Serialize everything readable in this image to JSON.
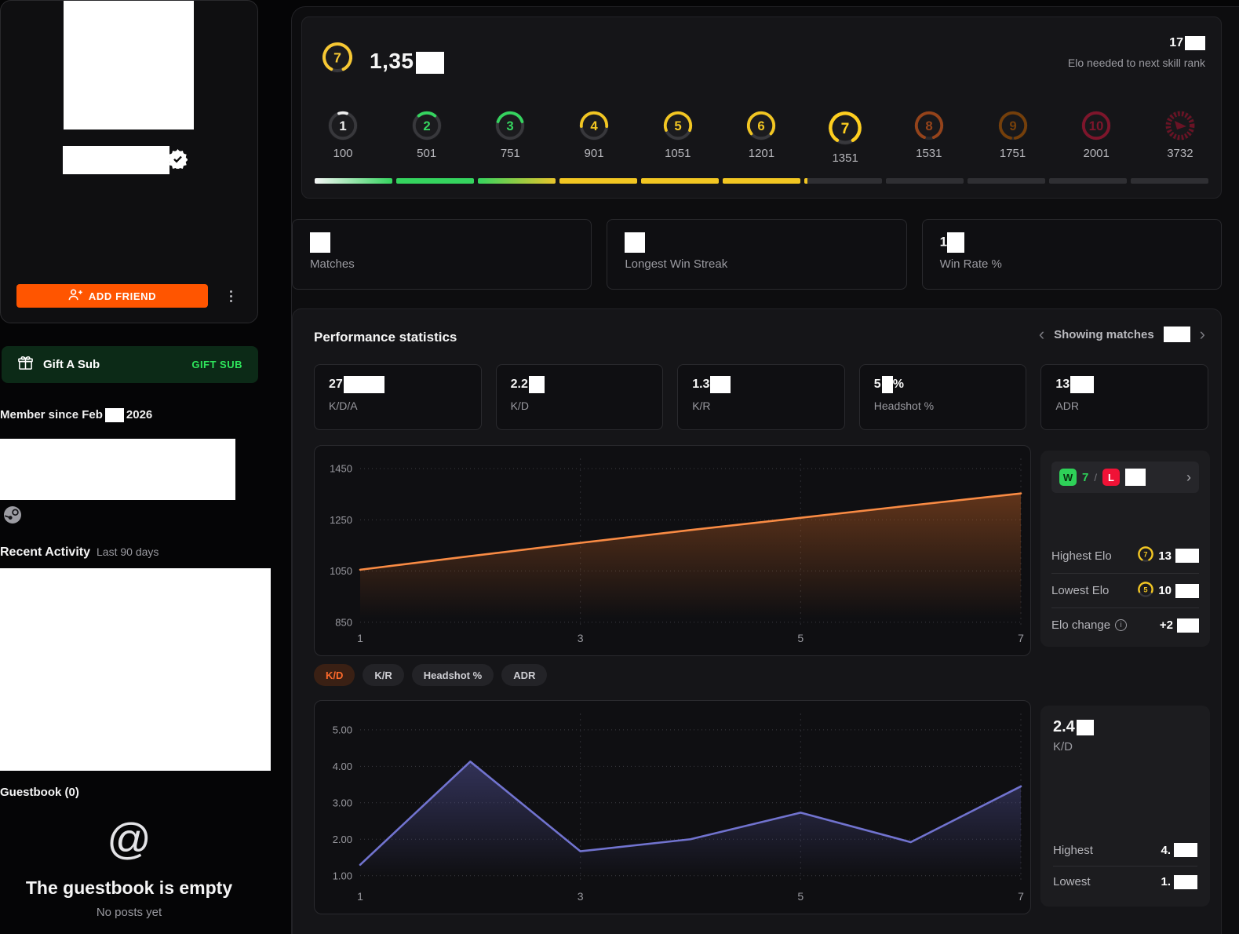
{
  "icons": {
    "chevron_left": "‹",
    "chevron_right": "›",
    "wl_chevron": "›",
    "info": "i",
    "at": "@"
  },
  "sidebar": {
    "add_friend_label": "ADD FRIEND",
    "gift_sub": {
      "title": "Gift A Sub",
      "button": "GIFT SUB"
    },
    "member_since_prefix": "Member since Feb",
    "member_since_suffix": "2026",
    "recent_activity_title": "Recent Activity",
    "recent_activity_range": "Last 90 days",
    "guestbook_title": "Guestbook (0)",
    "guestbook_empty_title": "The guestbook is empty",
    "guestbook_empty_subtitle": "No posts yet"
  },
  "header": {
    "elo_visible": "1,35",
    "badge": {
      "n": 7,
      "color": "#f7c833",
      "arc": 0.85
    },
    "next_rank_value": "17",
    "next_rank_label": "Elo needed to next skill rank"
  },
  "levels": [
    {
      "n": 1,
      "elo": "100",
      "color": "#ededed",
      "arc": 0.1,
      "progress": {
        "fill": "linear-gradient(90deg,#f5f5f5,#35d45f)"
      }
    },
    {
      "n": 2,
      "elo": "501",
      "color": "#35d45f",
      "arc": 0.22,
      "progress": {
        "fill": "#35d45f"
      }
    },
    {
      "n": 3,
      "elo": "751",
      "color": "#35d45f",
      "arc": 0.4,
      "progress": {
        "fill": "linear-gradient(90deg,#35d45f,#e8c52c)"
      }
    },
    {
      "n": 4,
      "elo": "901",
      "color": "#f2c622",
      "arc": 0.52,
      "progress": {
        "fill": "#f2c622"
      }
    },
    {
      "n": 5,
      "elo": "1051",
      "color": "#f2c622",
      "arc": 0.62,
      "progress": {
        "fill": "#f2c622"
      }
    },
    {
      "n": 6,
      "elo": "1201",
      "color": "#f2c622",
      "arc": 0.72,
      "progress": {
        "fill": "#f2c622"
      }
    },
    {
      "n": 7,
      "elo": "1351",
      "color": "#ffcf1f",
      "arc": 0.82,
      "current": true,
      "progress": {
        "fill": "#2f2f33",
        "partial": "#f2c622",
        "partial_pct": 4
      }
    },
    {
      "n": 8,
      "elo": "1531",
      "color": "#ff6a1d",
      "arc": 0.88,
      "dim": true,
      "progress": {
        "fill": "#2f2f33"
      }
    },
    {
      "n": 9,
      "elo": "1751",
      "color": "#c46300",
      "arc": 0.94,
      "dim": true,
      "progress": {
        "fill": "#2f2f33"
      }
    },
    {
      "n": 10,
      "elo": "2001",
      "color": "#d5163c",
      "arc": 1.0,
      "dim": true,
      "progress": {
        "fill": "#2f2f33"
      }
    },
    {
      "n": "challenger",
      "elo": "3732",
      "color": "#b01330",
      "dim": true,
      "progress": {
        "fill": "#2f2f33"
      }
    }
  ],
  "summary_cards": [
    {
      "value": "",
      "label": "Matches"
    },
    {
      "value": "",
      "label": "Longest Win Streak"
    },
    {
      "value": "1",
      "label": "Win Rate %"
    }
  ],
  "performance": {
    "title": "Performance statistics",
    "nav_label": "Showing matches",
    "stat_cards": [
      {
        "value": "27",
        "suffix": "",
        "label": "K/D/A"
      },
      {
        "value": "2.2",
        "suffix": "",
        "label": "K/D"
      },
      {
        "value": "1.3",
        "suffix": "",
        "label": "K/R"
      },
      {
        "value": "5",
        "suffix": "%",
        "label": "Headshot %"
      },
      {
        "value": "13",
        "suffix": "",
        "label": "ADR"
      }
    ],
    "elo_panel": {
      "win_letter": "W",
      "wins": "7",
      "slash": "/",
      "loss_letter": "L",
      "highest_label": "Highest Elo",
      "highest_value": "13",
      "highest_badge": {
        "n": 7,
        "color": "#f2c622",
        "arc": 0.82
      },
      "lowest_label": "Lowest Elo",
      "lowest_value": "10",
      "lowest_badge": {
        "n": 5,
        "color": "#f2c622",
        "arc": 0.62
      },
      "change_label": "Elo change",
      "change_value": "+2"
    },
    "tabs": [
      {
        "label": "K/D"
      },
      {
        "label": "K/R"
      },
      {
        "label": "Headshot %"
      },
      {
        "label": "ADR"
      }
    ],
    "kd_panel": {
      "value": "2.4",
      "label": "K/D",
      "highest_label": "Highest",
      "highest_value": "4.",
      "lowest_label": "Lowest",
      "lowest_value": "1."
    }
  },
  "chart_data": [
    {
      "type": "area",
      "name": "Elo",
      "x": [
        1,
        2,
        3,
        4,
        5,
        6,
        7
      ],
      "values": [
        1055,
        1108,
        1160,
        1210,
        1258,
        1306,
        1353
      ],
      "x_ticks": [
        1,
        3,
        5,
        7
      ],
      "y_ticks": [
        {
          "value": 1450,
          "label": "1450"
        },
        {
          "value": 1250,
          "label": "1250"
        },
        {
          "value": 1050,
          "label": "1050"
        },
        {
          "value": 850,
          "label": "850"
        }
      ],
      "ylim": [
        840,
        1490
      ],
      "grid": true,
      "line_color": "#f98b44",
      "fill_color": "#b35a22"
    },
    {
      "type": "area",
      "name": "K/D",
      "x": [
        1,
        2,
        3,
        4,
        5,
        6,
        7
      ],
      "values": [
        1.3,
        4.13,
        1.67,
        2.0,
        2.73,
        1.92,
        3.45
      ],
      "x_ticks": [
        1,
        3,
        5,
        7
      ],
      "y_ticks": [
        {
          "value": 5,
          "label": "5.00"
        },
        {
          "value": 4,
          "label": "4.00"
        },
        {
          "value": 3,
          "label": "3.00"
        },
        {
          "value": 2,
          "label": "2.00"
        },
        {
          "value": 1,
          "label": "1.00"
        }
      ],
      "ylim": [
        0.8,
        5.45
      ],
      "grid": true,
      "line_color": "#7173cf",
      "fill_color": "#55559e"
    }
  ]
}
